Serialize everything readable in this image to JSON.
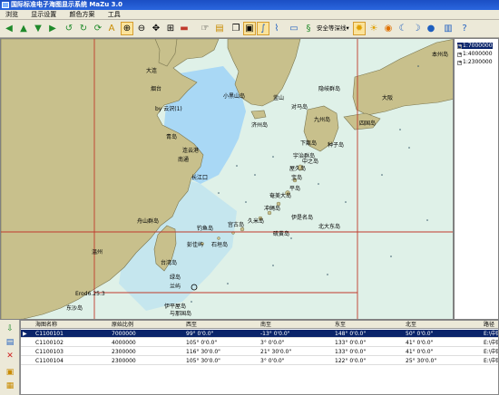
{
  "app": {
    "title": "国际标准电子海图显示系统 MaZu 3.0"
  },
  "menu": [
    "浏览",
    "显示设置",
    "颜色方案",
    "工具"
  ],
  "toolbar": {
    "display_mode": "安全等深线"
  },
  "sidebar": {
    "items": [
      "1:7000000",
      "1:4000000",
      "1:2300000"
    ]
  },
  "map_labels": {
    "ap1": "本州岛",
    "ap2": "大阪",
    "jp1": "四国岛",
    "jp2": "九州岛",
    "jp3": "隐岐群岛",
    "jp4": "济州岛",
    "kr1": "小黑山岛",
    "kr2": "釜山",
    "kr3": "对马岛",
    "cn1": "大连",
    "cn2": "烟台",
    "cn3": "青岛",
    "cn4": "连云港",
    "cn5": "南通",
    "cn6": "长江口",
    "cn7": "舟山群岛",
    "cn8": "温州",
    "tw1": "台湾岛",
    "tw2": "彭佳屿",
    "tw3": "钓鱼岛",
    "tw4": "石垣岛",
    "r1": "屋久岛",
    "r2": "奄美大岛",
    "r3": "冲绳岛",
    "r4": "宫古岛",
    "r5": "久米岛",
    "r6": "北大东岛",
    "r7": "硫黄岛",
    "r8": "伊平屋岛",
    "r9": "与那国岛",
    "r10": "东沙岛",
    "r11": "绿岛",
    "r12": "兰屿",
    "r13": "宝岛",
    "r14": "伊是名岛",
    "r15": "平岛",
    "r16": "下甑岛",
    "r17": "宇治群岛",
    "r18": "中之岛",
    "r19": "种子岛",
    "sea1": "by 云沢(1)",
    "sea2": "Erod6.25.3"
  },
  "table": {
    "headers": [
      "海图名称",
      "原始比例",
      "西至",
      "南至",
      "东至",
      "北至",
      "路径"
    ],
    "rows": [
      [
        "C1100101",
        "7000000",
        "99° 0'0.0\"",
        "-13° 0'0.0\"",
        "148° 0'0.0\"",
        "50° 0'0.0\"",
        "E:\\中国海"
      ],
      [
        "C1100102",
        "4000000",
        "105° 0'0.0\"",
        "3° 0'0.0\"",
        "133° 0'0.0\"",
        "41° 0'0.0\"",
        "E:\\中国海"
      ],
      [
        "C1100103",
        "2300000",
        "116° 30'0.0\"",
        "21° 30'0.0\"",
        "133° 0'0.0\"",
        "41° 0'0.0\"",
        "E:\\中国海"
      ],
      [
        "C1100104",
        "2300000",
        "105° 30'0.0\"",
        "3° 0'0.0\"",
        "122° 0'0.0\"",
        "25° 30'0.0\"",
        "E:\\中国海"
      ]
    ]
  },
  "colors": {
    "land": "#c8c08c",
    "deep_sea": "#dff1e8",
    "shallow": "#a9d8f5",
    "grid_red": "#c0392b",
    "selected": "#0a246a"
  }
}
